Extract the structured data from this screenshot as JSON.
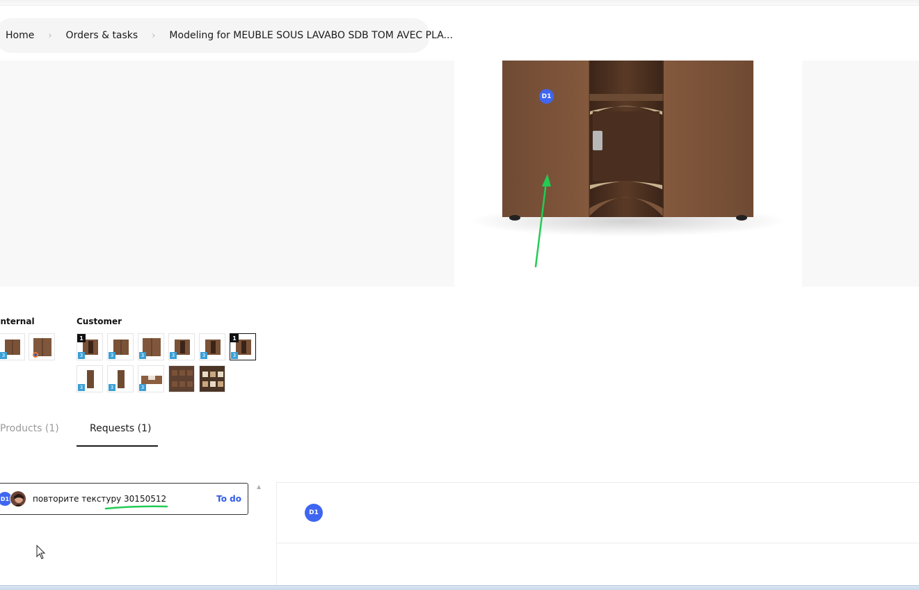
{
  "breadcrumb": {
    "items": [
      "Home",
      "Orders & tasks",
      "Modeling for MEUBLE SOUS LAVABO SDB TOM AVEC PLA..."
    ],
    "separator": "›"
  },
  "viewer": {
    "hotspot_label": "D1"
  },
  "gallery": {
    "internal_label": "Internal",
    "customer_label": "Customer",
    "badge_3d": "3",
    "flag_label": "1"
  },
  "tabs": {
    "products": "Products (1)",
    "requests": "Requests (1)"
  },
  "request": {
    "avatar_label": "D1",
    "text": "повторите текстуру 30150512",
    "status": "To do"
  },
  "detail": {
    "avatar_label": "D1"
  },
  "colors": {
    "accent_blue": "#3f66f0",
    "status_blue": "#2f5be6",
    "annotation_green": "#22cc55",
    "wood": "#7a5238"
  }
}
